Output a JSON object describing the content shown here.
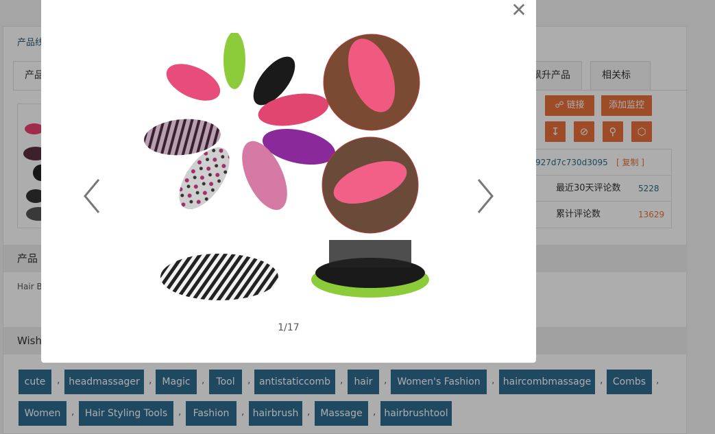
{
  "page": {
    "breadcrumb": "产品线",
    "tabs": {
      "first": "产品",
      "rising": "飙升产品",
      "tags": "相关标签"
    },
    "actions": {
      "link_label": "链接",
      "monitor_label": "添加监控",
      "icon_names": [
        "download-icon",
        "block-icon",
        "search-image-icon",
        "cube-icon"
      ]
    },
    "info": {
      "hash": "927d7c730d3095",
      "copy_label": "[ 复制 ]",
      "reviews30_label": "最近30天评论数",
      "reviews30_value": "5228",
      "reviews_total_label": "累计评论数",
      "reviews_total_value": "13629"
    },
    "section1_title": "产品",
    "section1_text": "Hair B",
    "section2_title": "Wish",
    "tags_row1": [
      "cute",
      "headmassager",
      "Magic",
      "Tool",
      "antistaticcomb",
      "hair",
      "Women's Fashion",
      "haircombmassage",
      "Combs"
    ],
    "tags_row2": [
      "Women",
      "Hair Styling Tools",
      "Fashion",
      "hairbrush",
      "Massage",
      "hairbrushtool"
    ],
    "separator": ","
  },
  "modal": {
    "counter": "1/17",
    "close_icon": "close-icon",
    "prev_icon": "chevron-left-icon",
    "next_icon": "chevron-right-icon"
  },
  "colors": {
    "accent": "#e8713a",
    "tag_bg": "#2e6a8f",
    "link_blue": "#2a6a8c"
  }
}
